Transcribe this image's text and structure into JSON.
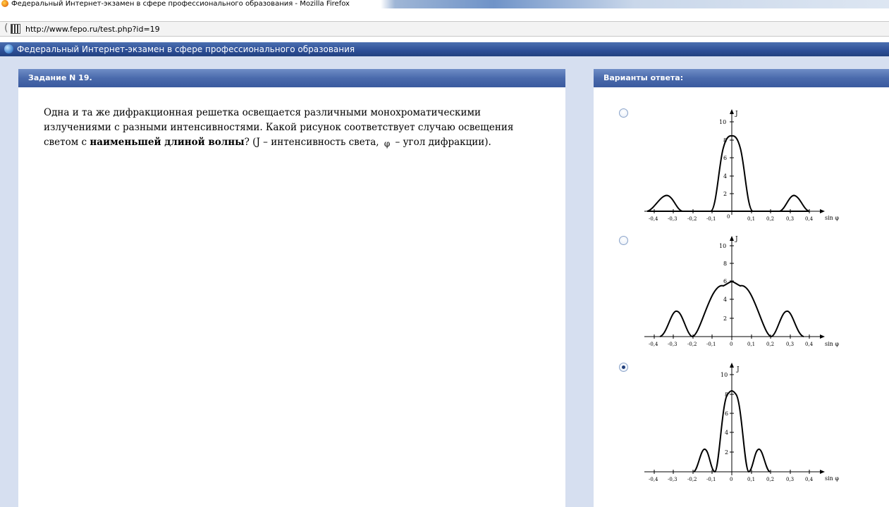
{
  "window": {
    "title": "Федеральный Интернет-экзамен в сфере профессионального образования - Mozilla Firefox"
  },
  "address_bar": {
    "url": "http://www.fepo.ru/test.php?id=19"
  },
  "site_header": {
    "title": "Федеральный Интернет-экзамен в сфере профессионального образования"
  },
  "task_panel": {
    "heading": "Задание N 19.",
    "text_part1": "Одна и та же дифракционная решетка освещается различными монохроматическими излучениями с разными интенсивностями. Какой рисунок соответствует случаю освещения светом с ",
    "text_bold": "наименьшей длиной волны",
    "text_part2": "? (J – интенсивность света, ",
    "phi_symbol": "φ",
    "text_part3": " – угол дифракции)."
  },
  "answers_panel": {
    "heading": "Варианты ответа:",
    "options": [
      {
        "checked": false,
        "graph": {
          "y_axis_label": "J",
          "x_axis_label": "sin φ",
          "y_ticks": [
            "2",
            "4",
            "6",
            "8",
            "10"
          ],
          "x_ticks_left": [
            "-0,4",
            "-0,3",
            "-0,2",
            "-0,1",
            "0"
          ],
          "x_ticks_right": [
            "0,1",
            "0,2",
            "0,3",
            "0,4"
          ]
        }
      },
      {
        "checked": false,
        "graph": {
          "y_axis_label": "J",
          "x_axis_label": "sin φ",
          "y_ticks": [
            "2",
            "4",
            "6",
            "8",
            "10"
          ],
          "x_ticks_left": [
            "-0,4",
            "-0,3",
            "-0,2",
            "-0,1",
            "0"
          ],
          "x_ticks_right": [
            "0,1",
            "0,2",
            "0,3",
            "0,4"
          ]
        }
      },
      {
        "checked": true,
        "graph": {
          "y_axis_label": "J",
          "x_axis_label": "sin φ",
          "y_ticks": [
            "2",
            "4",
            "6",
            "8",
            "10"
          ],
          "x_ticks_left": [
            "-0,4",
            "-0,3",
            "-0,2",
            "-0,1",
            "0"
          ],
          "x_ticks_right": [
            "0,1",
            "0,2",
            "0,3",
            "0,4"
          ]
        }
      }
    ]
  },
  "colors": {
    "page_background": "#d6dff0",
    "header_blue": "#2d4e96",
    "panel_heading": "#4a6aac"
  }
}
